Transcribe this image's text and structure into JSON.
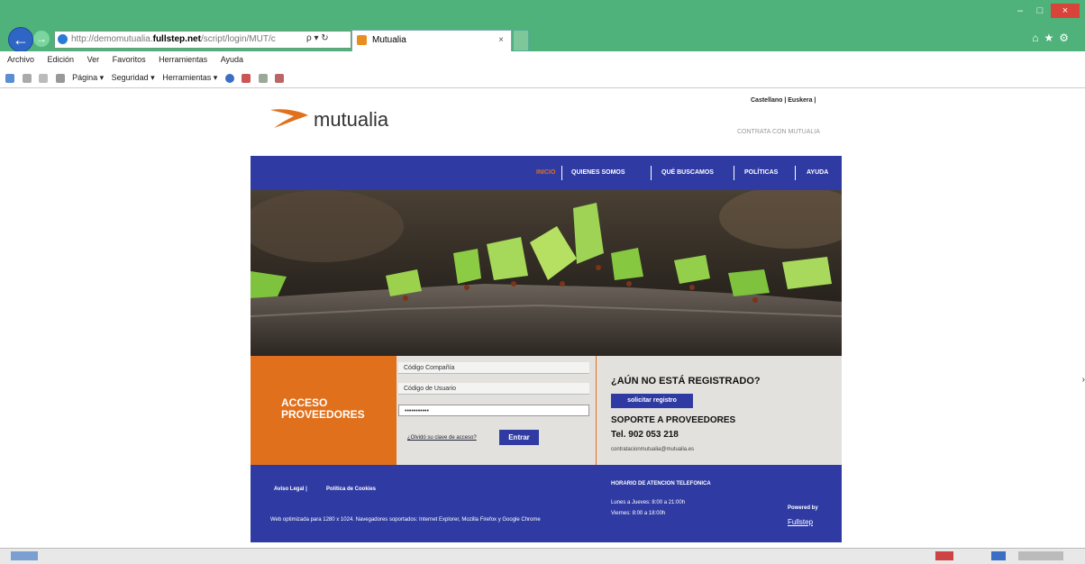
{
  "window": {
    "min": "–",
    "max": "□",
    "close": "×"
  },
  "browser": {
    "address_prefix": "http://demomutualia.",
    "address_domain": "fullstep.net",
    "address_rest": "/script/login/MUT/c",
    "address_tools": "ρ ▾ ↻",
    "tab_title": "Mutualia",
    "tab_close": "×",
    "right_icons": "⌂★⚙"
  },
  "menu": [
    "Archivo",
    "Edición",
    "Ver",
    "Favoritos",
    "Herramientas",
    "Ayuda"
  ],
  "commands": [
    "Página ▾",
    "Seguridad ▾",
    "Herramientas ▾"
  ],
  "site": {
    "logo": "mutualia",
    "langs": "Castellano | Euskera |",
    "contrata": "CONTRATA CON MUTUALIA",
    "nav": [
      "INICIO",
      "QUIENES SOMOS",
      "QUÉ BUSCAMOS",
      "POLÍTICAS",
      "AYUDA"
    ],
    "login": {
      "title_line1": "ACCESO",
      "title_line2": "PROVEEDORES",
      "company_placeholder": "Código Compañía",
      "user_placeholder": "Código de Usuario",
      "password_value": "•••••••••••",
      "forgot": "¿Olvidó su clave de acceso?",
      "submit": "Entrar"
    },
    "register": {
      "title": "¿AÚN NO ESTÁ REGISTRADO?",
      "button": "solicitar registro",
      "support": "SOPORTE A PROVEEDORES",
      "tel": "Tel. 902 053 218",
      "email": "contratacionmutualia@mutualia.es"
    },
    "footer": {
      "aviso": "Aviso Legal |",
      "cookies": "Política de Cookies",
      "optimized": "Web optimizada para 1280 x 1024. Navegadores soportados: Internet Explorer, Mozilla Firefox y Google Chrome",
      "horario_title": "HORARIO DE ATENCION TELEFONICA",
      "horario_1": "Lunes a Jueves: 8:00 a 21:00h",
      "horario_2": "Viernes: 8:00 a 18:00h",
      "powered": "Powered by",
      "fullstep": "Fullstep"
    }
  },
  "colors": {
    "nav_blue": "#2f3ba3",
    "orange": "#e0701c",
    "chrome_green": "#4fb27a"
  }
}
